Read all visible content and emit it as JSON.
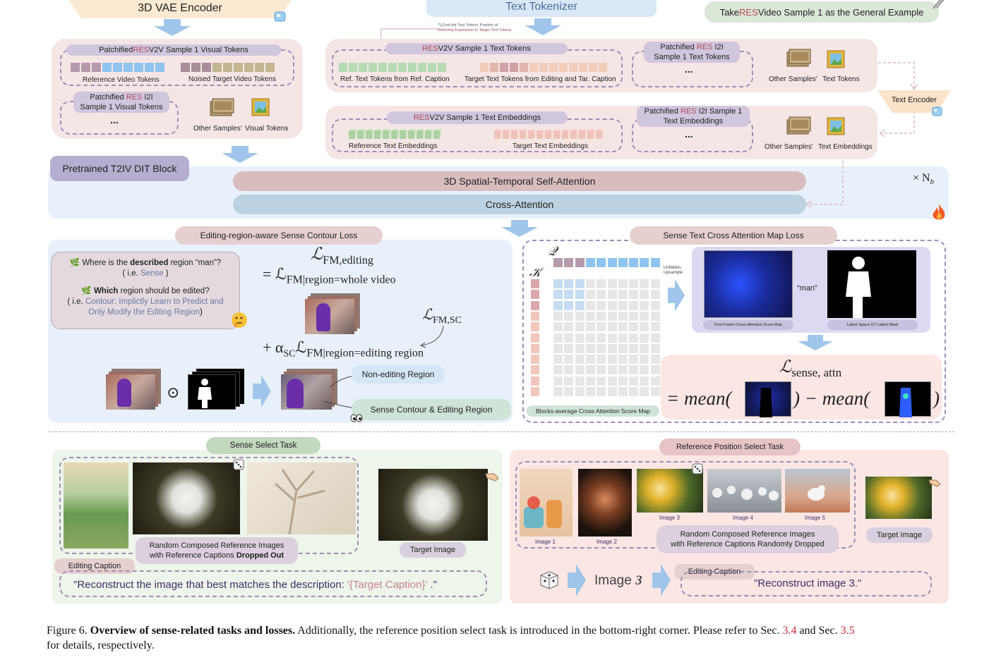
{
  "top_left": {
    "vae_encoder": "3D VAE Encoder",
    "visual_tokens_title_pre": "Patchified ",
    "visual_tokens_title_res": "RES",
    "visual_tokens_title_post": " V2V Sample 1 Visual Tokens",
    "reference_video_tokens": "Reference Video Tokens",
    "noised_target_tokens": "Noised Target Video Tokens",
    "i2i_visual_pre": "Patchified ",
    "i2i_visual_res": "RES",
    "i2i_visual_post": " I2I",
    "i2i_visual_line2": "Sample 1 Visual Tokens",
    "ellipsis": "...",
    "other_samples": "Other Samples'",
    "visual_tokens": "Visual Tokens"
  },
  "top_right": {
    "text_tokenizer": "Text Tokenizer",
    "general_example_pre": "Take ",
    "general_example_res": "RES",
    "general_example_post": " Video Sample 1 as the General Example",
    "find_note_line1": "Find the Text Tokens' Position of",
    "find_note_line2": "Referring Expression in Target Text Tokens",
    "text_tokens_title_res": "RES",
    "text_tokens_title_post": " V2V Sample 1 Text Tokens",
    "ref_text_tokens": "Ref. Text Tokens from Ref. Caption",
    "target_text_tokens": "Target Text Tokens from Editing and Tar. Caption",
    "i2i_text_pre": "Patchified ",
    "i2i_text_res": "RES",
    "i2i_text_post": " I2I",
    "i2i_text_line2": "Sample 1 Text Tokens",
    "ellipsis": "...",
    "other_samples": "Other Samples'",
    "text_tokens": "Text Tokens",
    "text_encoder": "Text Encoder",
    "emb_title_res": "RES",
    "emb_title_post": "  V2V Sample 1 Text Embeddings",
    "ref_text_emb": "Reference Text Embeddings",
    "target_text_emb": "Target Text Embeddings",
    "i2i_emb_pre": "Patchified ",
    "i2i_emb_res": "RES",
    "i2i_emb_post": " I2I Sample 1",
    "i2i_emb_line2": "Text Embeddings",
    "other_samples_2": "Other Samples'",
    "text_embeddings": "Text   Embeddings"
  },
  "dit": {
    "block_title": "Pretrained T2IV DIT Block",
    "self_attention": "3D Spatial-Temporal Self-Attention",
    "cross_attention": "Cross-Attention",
    "times_nb": "× N",
    "nb_sub": "b"
  },
  "contour_loss": {
    "title": "Editing-region-aware Sense Contour Loss",
    "q1_pre": "Where is the ",
    "q1_bold": "described",
    "q1_post": " region “man”?",
    "q1_ie_pre": "( i.e. ",
    "q1_ie_colored": "Sense",
    "q1_ie_post": " )",
    "q2_bold": "Which",
    "q2_post": " region should be edited?",
    "q2_ie_pre": "( i.e. ",
    "q2_ie_colored_1": "Contour: Implictly Learn to Predict and",
    "q2_ie_colored_2": "Only Modify the Editing Region",
    "q2_ie_post": ")",
    "eq_lhs": "ℒ",
    "eq_lhs_sub": "FM,editing",
    "eq_line2_pre": "= ℒ",
    "eq_line2_sub": "FM|region=whole video",
    "eq_fmsc": "ℒ",
    "eq_fmsc_sub": "FM,SC",
    "eq_line3_pre": "+ α",
    "eq_line3_alpha_sub": "SC",
    "eq_line3_l": "ℒ",
    "eq_line3_sub": "FM|region=editing region",
    "odot": "⊙",
    "non_editing": "Non-editing Region",
    "sense_contour": "Sense  Contour & Editing Region"
  },
  "cross_attn_loss": {
    "title": "Sense Text Cross Attention Map Loss",
    "q_label": "𝒬",
    "k_label": "𝒦",
    "unflatten": "Unflatten,",
    "upsample": "Upsample",
    "man": "“man”",
    "first_frame": "First Frame Cross-Attention Score Map",
    "latent_mask": "Latent Space GT Latent Mask",
    "blocks_avg": "Blocks-average Cross Attention Score Map",
    "loss_l": "ℒ",
    "loss_sub": "sense, attn",
    "mean_eq": "= mean(",
    "minus_mean": ") − mean(",
    "close": ")"
  },
  "sense_select": {
    "title": "Sense Select Task",
    "random_line1": "Random Composed Reference Images",
    "random_line2_pre": "with Reference Captions ",
    "random_line2_bold": "Dropped Out",
    "target_image": "Target Image",
    "editing_caption": "Editing Caption",
    "caption_pre": "\"Reconstruct the image that best matches the description:  ",
    "caption_colored": "'{Target Caption}'",
    "caption_post": " .\""
  },
  "ref_pos_select": {
    "title": "Reference Position Select Task",
    "image1": "Image 1",
    "image2": "Image 2",
    "image3": "Image 3",
    "image4": "Image 4",
    "image5": "Image 5",
    "random_line1": "Random Composed Reference Images",
    "random_line2": "with Reference Captions Randomly Dropped",
    "target_image": "Target Image",
    "image_num_label": "Image ",
    "image_num": "3",
    "editing_caption": "Editing Caption",
    "caption": "\"Reconstruct image 3.\""
  },
  "caption": {
    "fig": "Figure 6.",
    "bold": "Overview of sense-related tasks and losses.",
    "text1": " Additionally, the reference position select task is introduced in the bottom-right corner. Please refer to Sec. ",
    "ref1": "3.4",
    "text2": " and Sec. ",
    "ref2": "3.5",
    "text3": "for details, respectively."
  },
  "colors": {
    "res": "#b44a5a",
    "purple_pill": "#d0c6dd",
    "pink_panel": "#f6e9e9",
    "blue_panel": "#e8f1fb",
    "green_panel": "#eef5ea",
    "salmon_panel": "#fbe6e3",
    "arrow_blue": "#9fc6ea",
    "link_red": "#d2263a"
  }
}
